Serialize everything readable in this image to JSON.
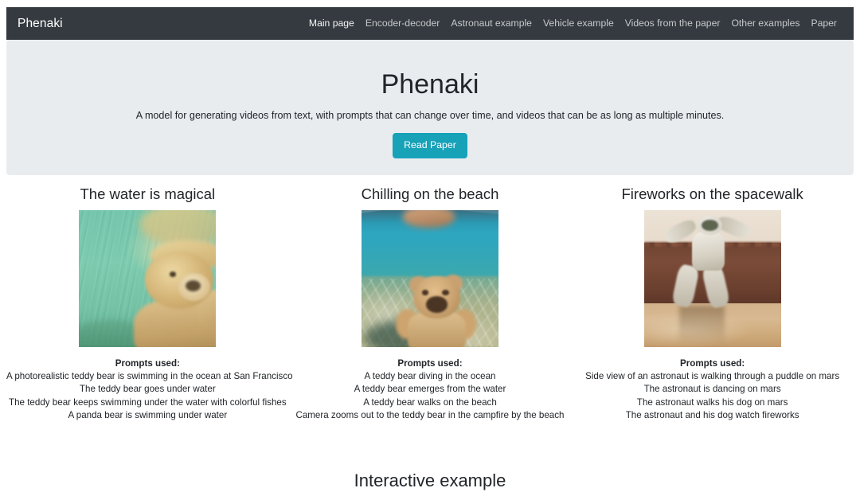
{
  "navbar": {
    "brand": "Phenaki",
    "links": [
      {
        "label": "Main page"
      },
      {
        "label": "Encoder-decoder"
      },
      {
        "label": "Astronaut example"
      },
      {
        "label": "Vehicle example"
      },
      {
        "label": "Videos from the paper"
      },
      {
        "label": "Other examples"
      },
      {
        "label": "Paper"
      }
    ]
  },
  "hero": {
    "title": "Phenaki",
    "lead": "A model for generating videos from text, with prompts that can change over time, and videos that can be as long as multiple minutes.",
    "button_label": "Read Paper",
    "background_color": "#e9ecef",
    "button_color": "#17a2b8"
  },
  "examples": {
    "prompts_label": "Prompts used:",
    "items": [
      {
        "title": "The water is magical",
        "media_name": "teddy-bear-underwater-video",
        "prompts": [
          "A photorealistic teddy bear is swimming in the ocean at San Francisco",
          "The teddy bear goes under water",
          "The teddy bear keeps swimming under the water with colorful fishes",
          "A panda bear is swimming under water"
        ]
      },
      {
        "title": "Chilling on the beach",
        "media_name": "teddy-bear-ocean-video",
        "prompts": [
          "A teddy bear diving in the ocean",
          "A teddy bear emerges from the water",
          "A teddy bear walks on the beach",
          "Camera zooms out to the teddy bear in the campfire by the beach"
        ]
      },
      {
        "title": "Fireworks on the spacewalk",
        "media_name": "astronaut-mars-video",
        "prompts": [
          "Side view of an astronaut is walking through a puddle on mars",
          "The astronaut is dancing on mars",
          "The astronaut walks his dog on mars",
          "The astronaut and his dog watch fireworks"
        ]
      }
    ]
  },
  "interactive": {
    "heading": "Interactive example"
  }
}
